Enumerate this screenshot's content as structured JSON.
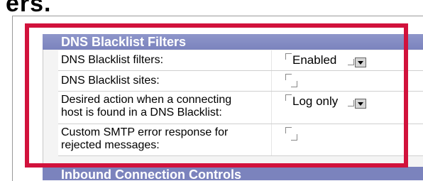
{
  "page_title_partial": "ers.",
  "section": {
    "title": "DNS Blacklist Filters"
  },
  "rows": [
    {
      "label": "DNS Blacklist filters:",
      "value": "Enabled",
      "has_select": true
    },
    {
      "label": "DNS Blacklist sites:",
      "value": "",
      "has_select": false
    },
    {
      "label": "Desired action when a connecting host is found in a DNS Blacklist:",
      "label_line1": "Desired action when a connecting",
      "label_line2": "host is found in a DNS Blacklist:",
      "value": "Log only",
      "has_select": true
    },
    {
      "label": "Custom SMTP error response for rejected messages:",
      "label_line1": "Custom SMTP error response for",
      "label_line2": "rejected messages:",
      "value": "",
      "has_select": false
    }
  ],
  "next_section": {
    "title": "Inbound Connection Controls"
  },
  "colors": {
    "highlight": "#d1123c",
    "header": "#7b83bd"
  }
}
